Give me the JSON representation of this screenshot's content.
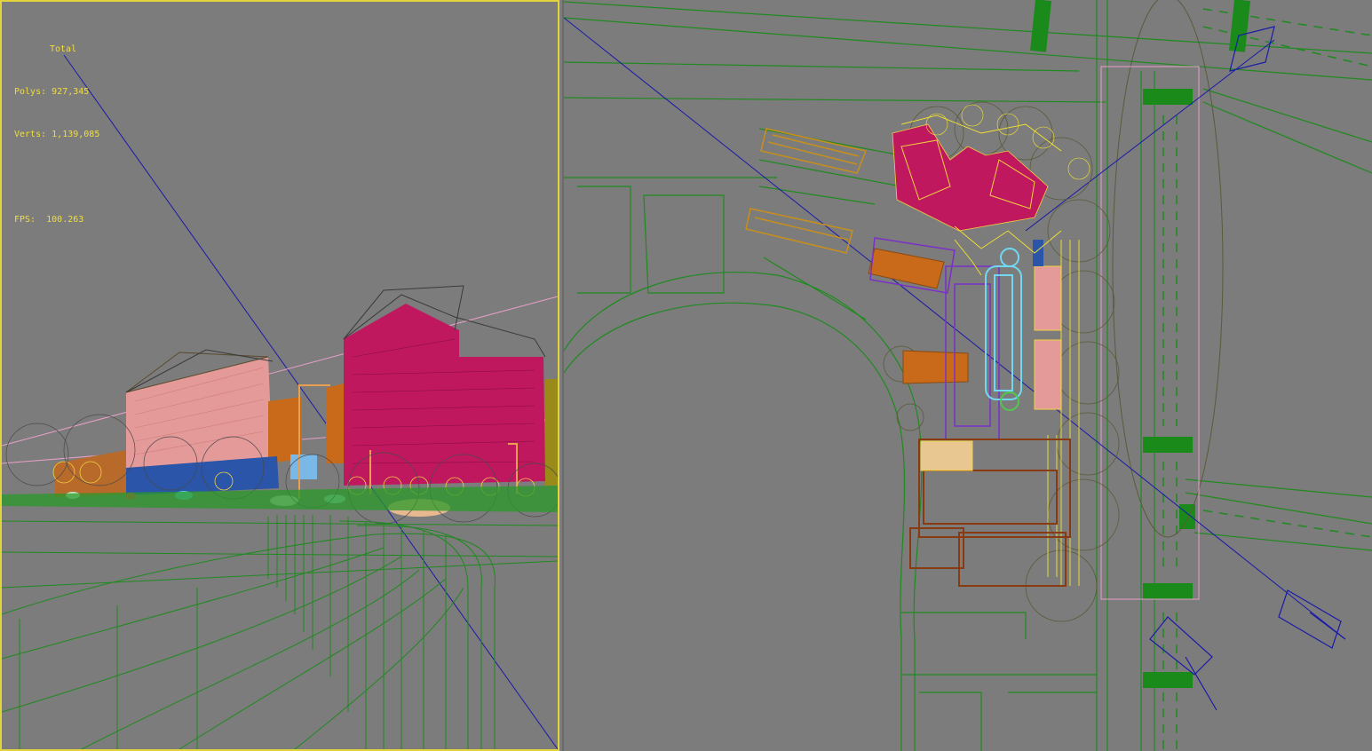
{
  "stats": {
    "title": "Total",
    "polys_label": "Polys:",
    "polys_value": "927,345",
    "verts_label": "Verts:",
    "verts_value": "1,139,085",
    "fps_label": "FPS:",
    "fps_value": "100.263"
  },
  "colors": {
    "viewport_bg": "#7c7c7c",
    "active_border": "#e2d43a",
    "stats_text": "#f0dd40",
    "wire_green": "#1f8a1f",
    "building_magenta": "#c0185f",
    "building_pink": "#e59a9a",
    "building_orange": "#c86a1a",
    "camera_blue": "#1a1aa8",
    "tree_yellow": "#f5e530"
  },
  "viewports": {
    "left": {
      "mode": "perspective",
      "active": true
    },
    "right": {
      "mode": "top",
      "active": false
    }
  }
}
